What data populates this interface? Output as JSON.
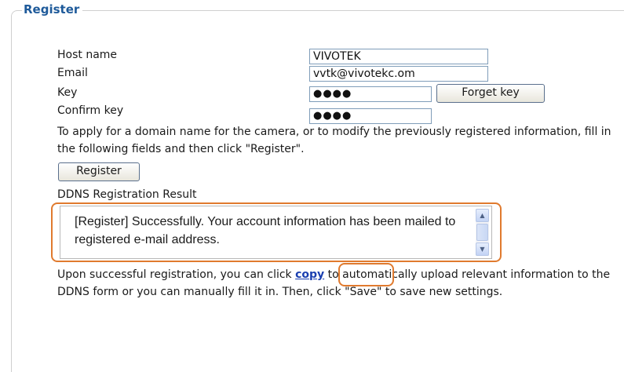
{
  "section": {
    "title": "Register"
  },
  "fields": {
    "host_name": {
      "label": "Host name",
      "value": "VIVOTEK"
    },
    "email": {
      "label": "Email",
      "value": "vvtk@vivotekc.om"
    },
    "key": {
      "label": "Key",
      "value": "●●●●"
    },
    "confirm_key": {
      "label": "Confirm key",
      "value": "●●●●"
    }
  },
  "buttons": {
    "forget_key": "Forget key",
    "register": "Register"
  },
  "instructions": "To apply for a domain name for the camera, or to modify the previously registered information, fill in the following fields and then click \"Register\".",
  "result": {
    "label": "DDNS Registration Result",
    "text": "[Register] Successfully. Your account information has been mailed to registered e-mail address."
  },
  "footer": {
    "before": "Upon successful registration, you can click ",
    "link": "copy",
    "after": " to automatically upload relevant information to the DDNS form or you can manually fill it in. Then, click \"Save\" to save new settings."
  },
  "colors": {
    "legend": "#1e5a9a",
    "highlight": "#e07a2e",
    "link": "#1a3fb0"
  }
}
